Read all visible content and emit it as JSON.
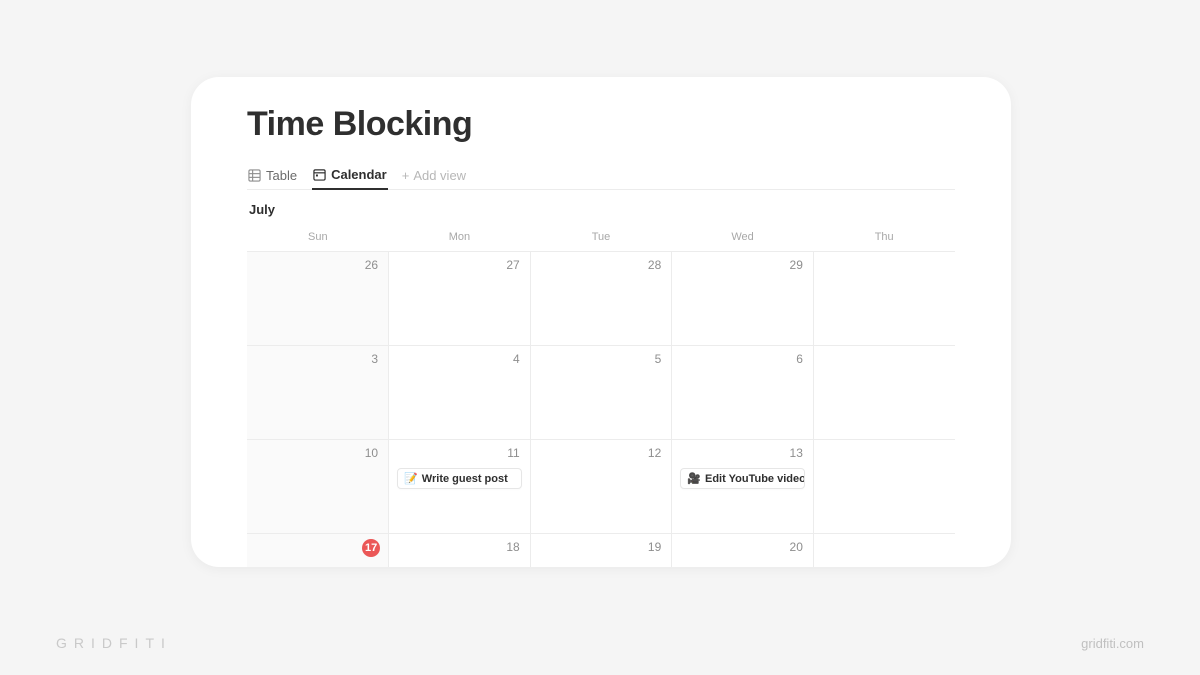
{
  "page": {
    "title": "Time Blocking"
  },
  "tabs": {
    "table": "Table",
    "calendar": "Calendar",
    "add_view": "Add view"
  },
  "month_label": "July",
  "weekdays": [
    "Sun",
    "Mon",
    "Tue",
    "Wed",
    "Thu"
  ],
  "rows": [
    {
      "days": [
        "26",
        "27",
        "28",
        "29",
        ""
      ],
      "shaded": [
        true,
        false,
        false,
        false,
        false
      ]
    },
    {
      "days": [
        "3",
        "4",
        "5",
        "6",
        ""
      ],
      "shaded": [
        true,
        false,
        false,
        false,
        false
      ]
    },
    {
      "days": [
        "10",
        "11",
        "12",
        "13",
        ""
      ],
      "shaded": [
        true,
        false,
        false,
        false,
        false
      ]
    },
    {
      "days": [
        "17",
        "18",
        "19",
        "20",
        ""
      ],
      "shaded": [
        true,
        false,
        false,
        false,
        false
      ]
    }
  ],
  "today": "17",
  "events": {
    "11": {
      "emoji": "📝",
      "title": "Write guest post"
    },
    "13": {
      "emoji": "🎥",
      "title": "Edit YouTube video"
    }
  },
  "branding": {
    "logo_text": "GRIDFITI",
    "url_text": "gridfiti.com"
  },
  "colors": {
    "accent_today": "#eb5757"
  }
}
